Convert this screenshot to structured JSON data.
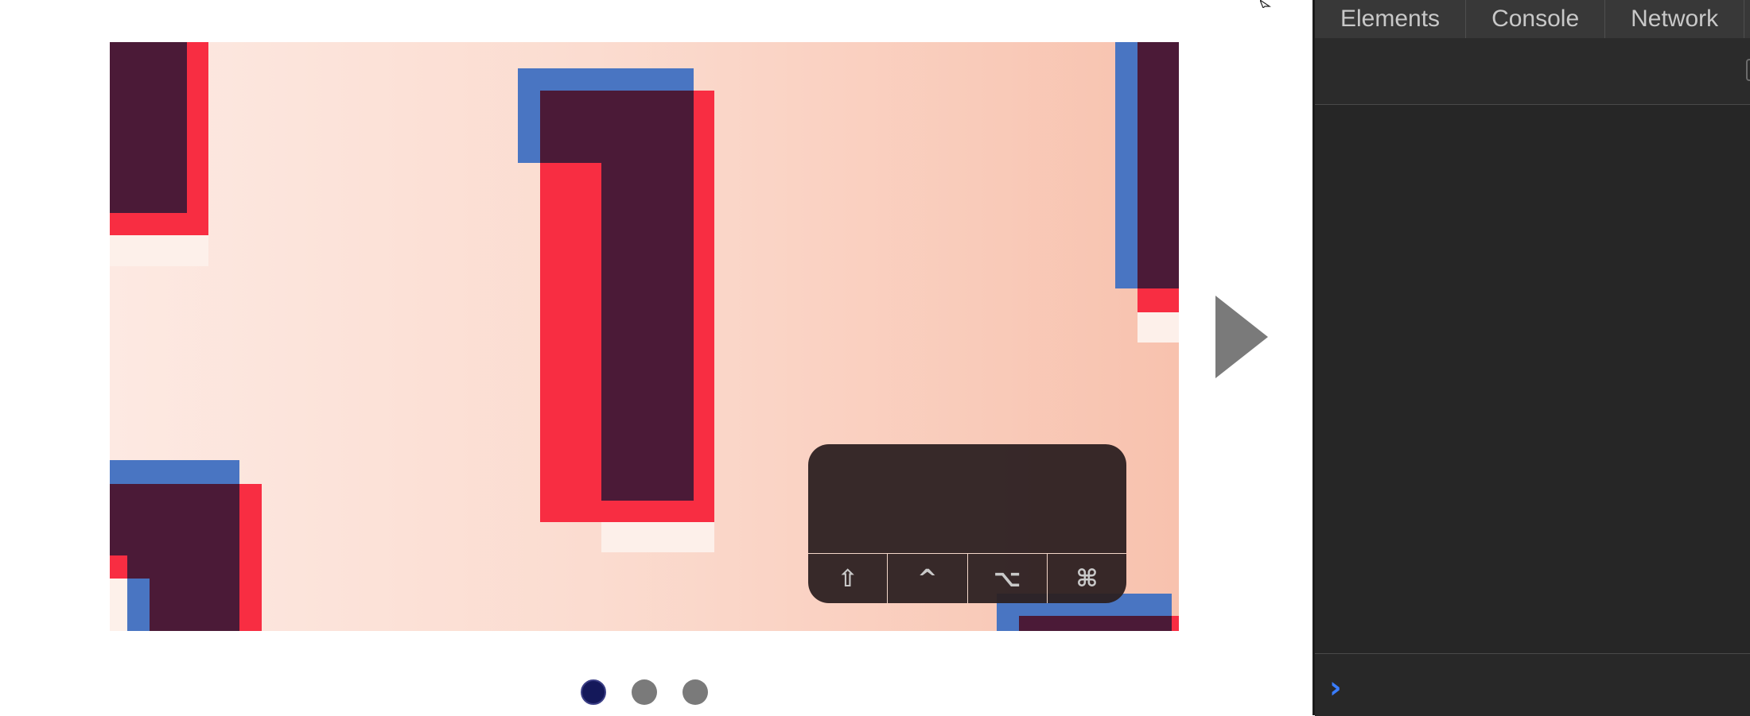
{
  "slideshow": {
    "dots": [
      {
        "active": true
      },
      {
        "active": false
      },
      {
        "active": false
      }
    ]
  },
  "keyboard_overlay": {
    "keys": [
      {
        "symbol": "⇧",
        "name": "shift-key"
      },
      {
        "symbol": "^",
        "name": "control-key"
      },
      {
        "symbol": "⌥",
        "name": "option-key"
      },
      {
        "symbol": "⌘",
        "name": "command-key"
      }
    ]
  },
  "devtools": {
    "tabs": [
      "Elements",
      "Console",
      "Network"
    ],
    "prompt_symbol": "›"
  },
  "colors": {
    "dark_block": "#4b1a37",
    "red": "#f82d42",
    "blue": "#4975c2",
    "light": "#fcebe4",
    "active_dot": "#14185a",
    "inactive_dot": "#7a7a7a"
  }
}
